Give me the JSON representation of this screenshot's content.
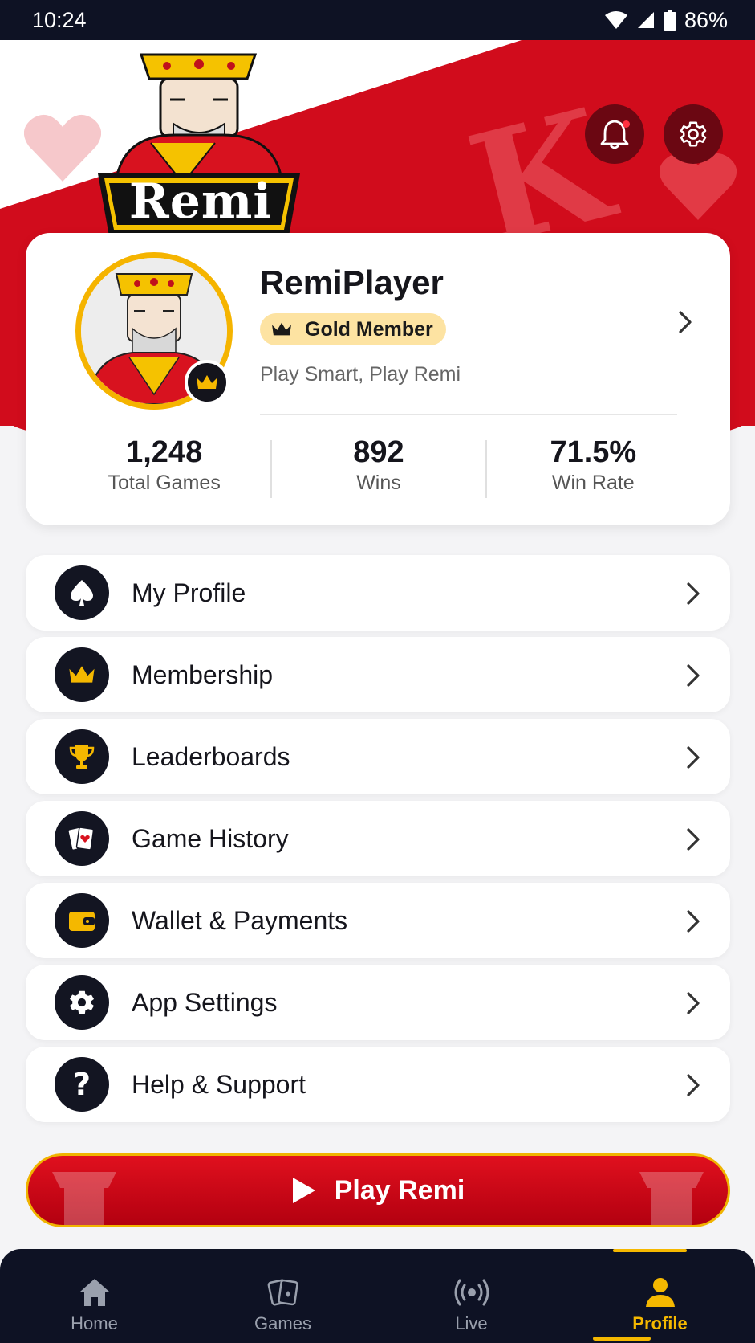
{
  "status_bar": {
    "time": "10:24",
    "battery": "86%"
  },
  "header": {
    "logo_text": "Remi"
  },
  "profile": {
    "username": "RemiPlayer",
    "badge": "Gold Member",
    "tagline": "Play Smart, Play Remi",
    "stats": [
      {
        "value": "1,248",
        "label": "Total Games"
      },
      {
        "value": "892",
        "label": "Wins"
      },
      {
        "value": "71.5%",
        "label": "Win Rate"
      }
    ]
  },
  "menu": [
    {
      "label": "My Profile",
      "icon": "spade-icon"
    },
    {
      "label": "Membership",
      "icon": "crown-icon"
    },
    {
      "label": "Leaderboards",
      "icon": "trophy-icon"
    },
    {
      "label": "Game History",
      "icon": "cards-icon"
    },
    {
      "label": "Wallet & Payments",
      "icon": "wallet-icon"
    },
    {
      "label": "App Settings",
      "icon": "gear-icon"
    },
    {
      "label": "Help & Support",
      "icon": "question-icon"
    }
  ],
  "play_button": {
    "label": "Play Remi"
  },
  "bottom_nav": [
    {
      "label": "Home",
      "icon": "home-icon"
    },
    {
      "label": "Games",
      "icon": "cards-icon"
    },
    {
      "label": "Live",
      "icon": "broadcast-icon"
    },
    {
      "label": "Profile",
      "icon": "person-icon",
      "active": true
    }
  ],
  "colors": {
    "primary_red": "#d50d1c",
    "gold": "#f5b800",
    "dark_navy": "#0e1224",
    "badge_bg": "#fde3a2"
  }
}
